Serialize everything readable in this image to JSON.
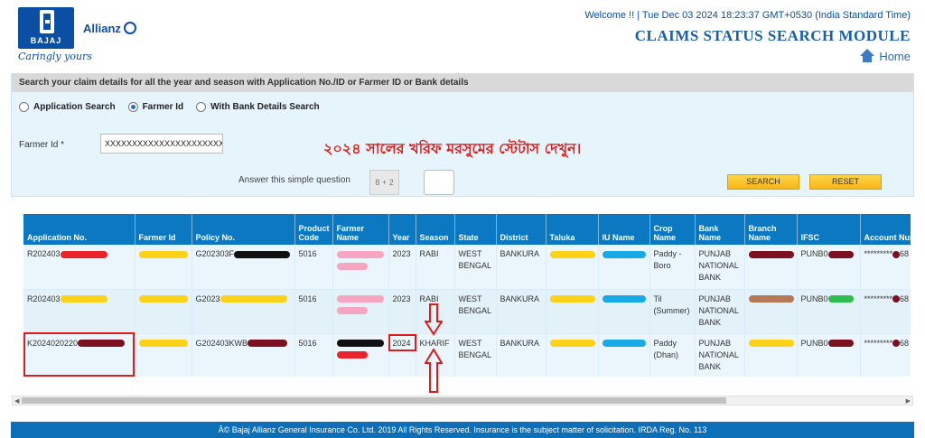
{
  "header": {
    "logo_text": "BAJAJ",
    "brand": "Allianz",
    "tagline": "Caringly yours",
    "welcome": "Welcome !! | Tue Dec 03 2024 18:23:37 GMT+0530 (India Standard Time)",
    "title": "CLAIMS STATUS SEARCH MODULE",
    "home_label": "Home"
  },
  "search": {
    "panel_title": "Search your claim details for all the year and season with Application No./ID or Farmer ID or Bank details",
    "radio_application": "Application Search",
    "radio_farmer": "Farmer Id",
    "radio_bank": "With Bank Details Search",
    "selected": "Farmer Id",
    "farmer_label": "Farmer Id  *",
    "farmer_value": "XXXXXXXXXXXXXXXXXXXXXXX",
    "bengali_note": "২০২৪ সালের খরিফ মরসুমের স্টেটাস দেখুন।",
    "question_label": "Answer this simple question",
    "captcha": "8 + 2",
    "search_button": "SEARCH",
    "reset_button": "RESET"
  },
  "table": {
    "headers": [
      "Application No.",
      "Farmer Id",
      "Policy No.",
      "Product Code",
      "Farmer Name",
      "Year",
      "Season",
      "State",
      "District",
      "Taluka",
      "IU Name",
      "Crop Name",
      "Bank Name",
      "Branch Name",
      "IFSC",
      "Account Number"
    ],
    "rows": [
      {
        "app": "R202403",
        "policy": "G202303F",
        "product": "5016",
        "year": "2023",
        "season": "RABI",
        "state": "WEST BENGAL",
        "district": "BANKURA",
        "crop": "Paddy - Boro",
        "bank": "PUNJAB NATIONAL BANK",
        "ifsc": "PUNB0",
        "account": "*********",
        "account_tail": "68"
      },
      {
        "app": "R202403",
        "policy": "G2023",
        "product": "5016",
        "year": "2023",
        "season": "RABI",
        "state": "WEST BENGAL",
        "district": "BANKURA",
        "crop": "Til (Summer)",
        "bank": "PUNJAB NATIONAL BANK",
        "ifsc": "PUNB0",
        "account": "*********",
        "account_tail": "68"
      },
      {
        "app": "K2024020220",
        "policy": "G202403KWB",
        "product": "5016",
        "year": "2024",
        "season": "KHARIF",
        "state": "WEST BENGAL",
        "district": "BANKURA",
        "crop": "Paddy (Dhan)",
        "bank": "PUNJAB NATIONAL BANK",
        "ifsc": "PUNB0",
        "account": "*********",
        "account_tail": "68"
      }
    ]
  },
  "footer": {
    "text": "Â© Bajaj Allianz General Insurance Co. Ltd. 2019 All Rights Reserved. Insurance is the subject matter of solicitation. IRDA Reg. No. 113"
  },
  "colors": {
    "header_blue": "#0d78c2",
    "title_blue": "#1a5ea8",
    "panel_bg": "#e6f4fb",
    "button_yellow": "#f7b515",
    "annotation_red": "#e01b1b"
  }
}
